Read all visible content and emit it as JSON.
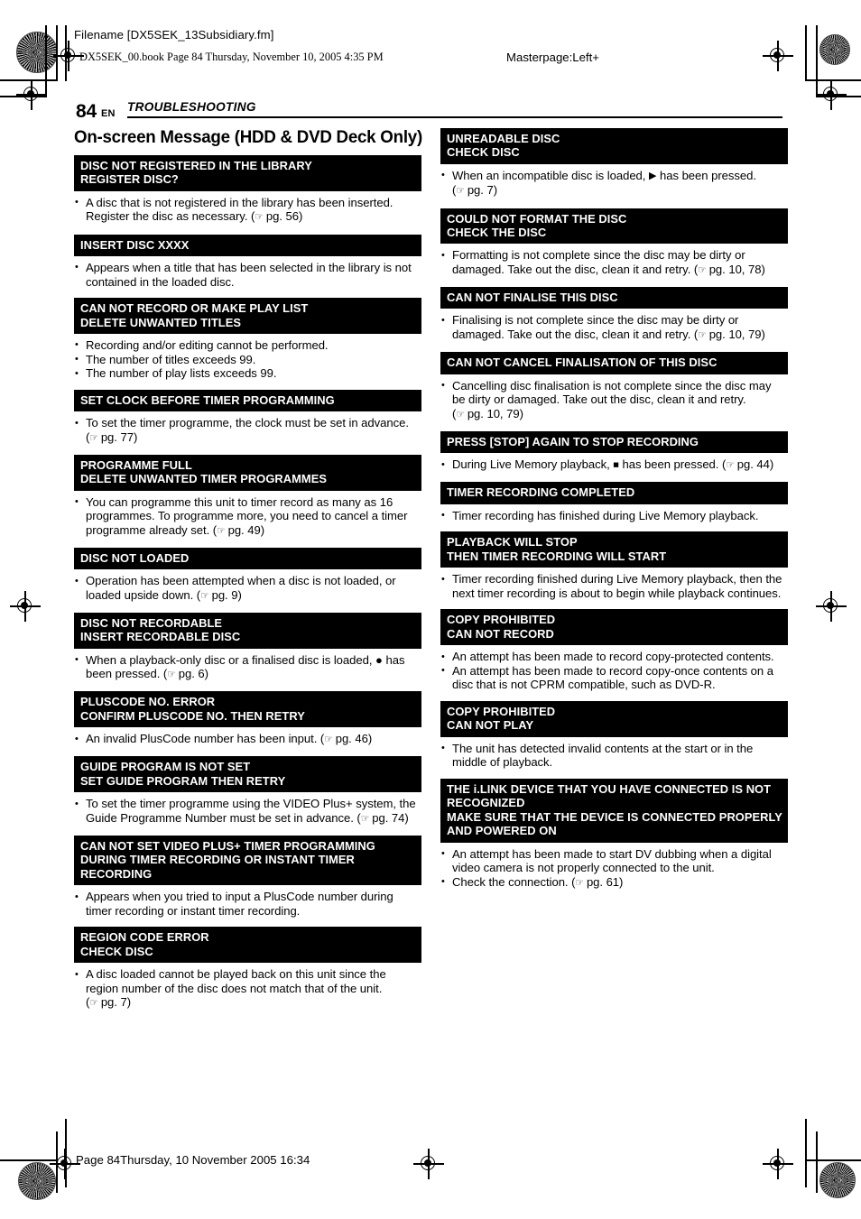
{
  "page_header": {
    "filename_line": "Filename [DX5SEK_13Subsidiary.fm]",
    "book_line": "DX5SEK_00.book  Page 84  Thursday, November 10, 2005  4:35 PM",
    "masterpage": "Masterpage:Left+"
  },
  "folio": {
    "page_number": "84",
    "language_code": "EN",
    "chapter": "TROUBLESHOOTING"
  },
  "section": {
    "title": "On-screen Message (HDD & DVD Deck Only)"
  },
  "glyphs": {
    "bullet": "•",
    "reference_hand": "☞",
    "play": "▶",
    "stop": "■",
    "record": "●"
  },
  "left_column": [
    {
      "bar": [
        "DISC NOT REGISTERED IN THE LIBRARY",
        "REGISTER DISC?"
      ],
      "items": [
        [
          {
            "t": "A disc that is not registered in the library has been inserted. Register the disc as necessary. ("
          },
          {
            "ref": "pg. 56"
          },
          {
            "t": ")"
          }
        ]
      ]
    },
    {
      "bar": [
        "INSERT DISC XXXX"
      ],
      "items": [
        [
          {
            "t": "Appears when a title that has been selected in the library is not contained in the loaded disc."
          }
        ]
      ]
    },
    {
      "bar": [
        "CAN NOT RECORD OR MAKE PLAY LIST",
        "DELETE UNWANTED TITLES"
      ],
      "items": [
        [
          {
            "t": "Recording and/or editing cannot be performed."
          }
        ],
        [
          {
            "t": "The number of titles exceeds 99."
          }
        ],
        [
          {
            "t": "The number of play lists exceeds 99."
          }
        ]
      ]
    },
    {
      "bar": [
        "SET CLOCK BEFORE TIMER PROGRAMMING"
      ],
      "items": [
        [
          {
            "t": "To set the timer programme, the clock must be set in advance. ("
          },
          {
            "ref": "pg. 77"
          },
          {
            "t": ")"
          }
        ]
      ]
    },
    {
      "bar": [
        "PROGRAMME FULL",
        "DELETE UNWANTED TIMER PROGRAMMES"
      ],
      "items": [
        [
          {
            "t": "You can programme this unit to timer record as many as 16 programmes. To programme more, you need to cancel a timer programme already set. ("
          },
          {
            "ref": "pg. 49"
          },
          {
            "t": ")"
          }
        ]
      ]
    },
    {
      "bar": [
        "DISC NOT LOADED"
      ],
      "items": [
        [
          {
            "t": "Operation has been attempted when a disc is not loaded, or loaded upside down. ("
          },
          {
            "ref": "pg. 9"
          },
          {
            "t": ")"
          }
        ]
      ]
    },
    {
      "bar": [
        "DISC NOT RECORDABLE",
        "INSERT RECORDABLE DISC"
      ],
      "items": [
        [
          {
            "t": "When a playback-only disc or a finalised disc is loaded, "
          },
          {
            "glyph": "record"
          },
          {
            "t": " has been pressed. ("
          },
          {
            "ref": "pg. 6"
          },
          {
            "t": ")"
          }
        ]
      ]
    },
    {
      "bar": [
        "PLUSCODE NO. ERROR",
        "CONFIRM PLUSCODE NO. THEN RETRY"
      ],
      "items": [
        [
          {
            "t": "An invalid PlusCode number has been input. ("
          },
          {
            "ref": "pg. 46"
          },
          {
            "t": ")"
          }
        ]
      ]
    },
    {
      "bar": [
        "GUIDE PROGRAM IS NOT SET",
        "SET GUIDE PROGRAM THEN RETRY"
      ],
      "items": [
        [
          {
            "t": "To set the timer programme using the VIDEO Plus+ system, the Guide Programme Number must be set in advance. ("
          },
          {
            "ref": "pg. 74"
          },
          {
            "t": ")"
          }
        ]
      ]
    },
    {
      "bar": [
        "CAN NOT SET VIDEO PLUS+ TIMER PROGRAMMING",
        "DURING TIMER RECORDING OR INSTANT TIMER",
        "RECORDING"
      ],
      "items": [
        [
          {
            "t": "Appears when you tried to input a PlusCode number during timer recording or instant timer recording."
          }
        ]
      ]
    },
    {
      "bar": [
        "REGION CODE ERROR",
        "CHECK DISC"
      ],
      "items": [
        [
          {
            "t": "A disc loaded cannot be played back on this unit since the region number of the disc does not match that of the unit. ("
          },
          {
            "ref": "pg. 7"
          },
          {
            "t": ")"
          }
        ]
      ]
    }
  ],
  "right_column": [
    {
      "bar": [
        "UNREADABLE DISC",
        "CHECK DISC"
      ],
      "items": [
        [
          {
            "t": "When an incompatible disc is loaded, "
          },
          {
            "glyph": "play"
          },
          {
            "t": " has been pressed. ("
          },
          {
            "ref": "pg. 7"
          },
          {
            "t": ")"
          }
        ]
      ]
    },
    {
      "bar": [
        "COULD NOT FORMAT THE DISC",
        "CHECK THE DISC"
      ],
      "items": [
        [
          {
            "t": "Formatting is not complete since the disc may be dirty or damaged. Take out the disc, clean it and retry. ("
          },
          {
            "ref": "pg. 10, 78"
          },
          {
            "t": ")"
          }
        ]
      ]
    },
    {
      "bar": [
        "CAN NOT FINALISE THIS DISC"
      ],
      "items": [
        [
          {
            "t": "Finalising is not complete since the disc may be dirty or damaged. Take out the disc, clean it and retry. ("
          },
          {
            "ref": "pg. 10, 79"
          },
          {
            "t": ")"
          }
        ]
      ]
    },
    {
      "bar": [
        "CAN NOT CANCEL FINALISATION OF THIS DISC"
      ],
      "items": [
        [
          {
            "t": "Cancelling disc finalisation is not complete since the disc may be dirty or damaged. Take out the disc, clean it and retry. ("
          },
          {
            "ref": "pg. 10, 79"
          },
          {
            "t": ")"
          }
        ]
      ]
    },
    {
      "bar": [
        "PRESS [STOP] AGAIN TO STOP RECORDING"
      ],
      "items": [
        [
          {
            "t": "During Live Memory playback, "
          },
          {
            "glyph": "stop"
          },
          {
            "t": " has been pressed. ("
          },
          {
            "ref": "pg. 44"
          },
          {
            "t": ")"
          }
        ]
      ]
    },
    {
      "bar": [
        "TIMER RECORDING COMPLETED"
      ],
      "items": [
        [
          {
            "t": "Timer recording has finished during Live Memory playback."
          }
        ]
      ]
    },
    {
      "bar": [
        "PLAYBACK WILL STOP",
        "THEN TIMER RECORDING WILL START"
      ],
      "items": [
        [
          {
            "t": "Timer recording finished during Live Memory playback, then the next timer recording is about to begin while playback continues."
          }
        ]
      ]
    },
    {
      "bar": [
        "COPY PROHIBITED",
        "CAN NOT RECORD"
      ],
      "items": [
        [
          {
            "t": "An attempt has been made to record copy-protected contents."
          }
        ],
        [
          {
            "t": "An attempt has been made to record copy-once contents on a disc that is not CPRM compatible, such as DVD-R."
          }
        ]
      ]
    },
    {
      "bar": [
        "COPY PROHIBITED",
        "CAN NOT PLAY"
      ],
      "items": [
        [
          {
            "t": "The unit has detected invalid contents at the start or in the middle of playback."
          }
        ]
      ]
    },
    {
      "bar": [
        "THE i.LINK DEVICE THAT YOU HAVE CONNECTED IS NOT",
        "RECOGNIZED",
        "MAKE SURE THAT THE DEVICE IS CONNECTED PROPERLY",
        "AND POWERED ON"
      ],
      "items": [
        [
          {
            "t": "An attempt has been made to start DV dubbing when a digital video camera is not properly connected to the unit."
          }
        ],
        [
          {
            "t": "Check the connection. ("
          },
          {
            "ref": "pg. 61"
          },
          {
            "t": ")"
          }
        ]
      ]
    }
  ],
  "footer": {
    "text": "Page 84Thursday, 10 November 2005  16:34"
  }
}
